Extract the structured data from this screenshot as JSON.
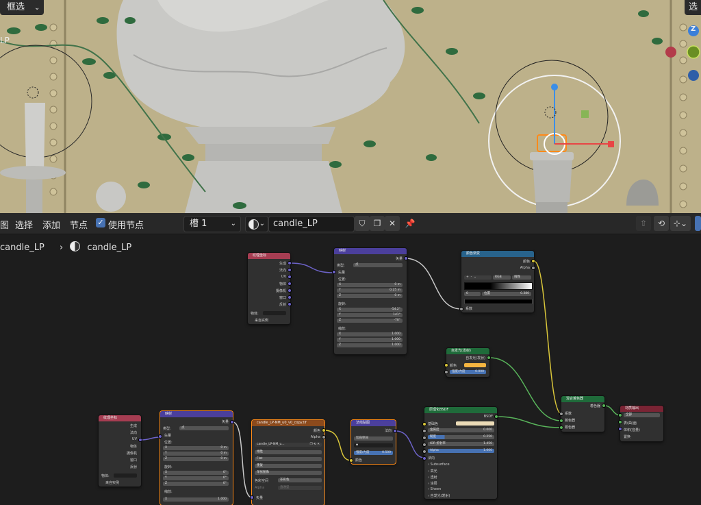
{
  "viewport": {
    "select_mode": "框选",
    "left_label": "LP",
    "right_label": "选",
    "gizmo_z": "Z"
  },
  "header": {
    "menu": [
      "图",
      "选择",
      "添加",
      "节点"
    ],
    "use_nodes_label": "使用节点",
    "slot": "槽 1",
    "material_name": "candle_LP"
  },
  "breadcrumb": {
    "object": "candle_LP",
    "material": "candle_LP"
  },
  "nodes": {
    "texcoord_top": {
      "title": "纹理坐标",
      "outputs": [
        "生成",
        "法向",
        "UV",
        "物体",
        "摄像机",
        "窗口",
        "反射"
      ],
      "object_label": "物体:",
      "from_instancer": "来自实例"
    },
    "mapping_top": {
      "title": "映射",
      "output": "矢量",
      "type_label": "类型:",
      "type_value": "点",
      "input_vector": "矢量",
      "location_label": "位置:",
      "location": [
        {
          "axis": "X",
          "val": "0 m"
        },
        {
          "axis": "Y",
          "val": "0.25 m"
        },
        {
          "axis": "Z",
          "val": "0 m"
        }
      ],
      "rotation_label": "旋转:",
      "rotation": [
        {
          "axis": "X",
          "val": "-54.2°"
        },
        {
          "axis": "Y",
          "val": "141°"
        },
        {
          "axis": "Z",
          "val": "-70°"
        }
      ],
      "scale_label": "缩放:",
      "scale": [
        {
          "axis": "X",
          "val": "1.000"
        },
        {
          "axis": "Y",
          "val": "1.000"
        },
        {
          "axis": "Z",
          "val": "1.000"
        }
      ]
    },
    "colorramp": {
      "title": "颜色渐变",
      "outputs": [
        "颜色",
        "Alpha"
      ],
      "mode": "RGB",
      "interp": "线性",
      "pos_index": "0",
      "pos_label": "位置",
      "pos_value": "0.380",
      "input": "系数"
    },
    "emission": {
      "title": "自发光(发射)",
      "output": "自发光(发射)",
      "color_label": "颜色",
      "strength_label": "强度/力度",
      "strength_value": "0.000",
      "color_hex": "#f5b540"
    },
    "mix_shader": {
      "title": "混合着色器",
      "output": "着色器",
      "inputs": [
        "系数",
        "着色器",
        "着色器"
      ]
    },
    "material_output": {
      "title": "材质输出",
      "target": "全部",
      "inputs": [
        "表(曲)面",
        "体积(音量)",
        "置换"
      ]
    },
    "texcoord_bottom": {
      "title": "纹理坐标",
      "outputs": [
        "生成",
        "法向",
        "UV",
        "物体",
        "摄像机",
        "窗口",
        "反射"
      ],
      "object_label": "物体:",
      "from_instancer": "来自实例"
    },
    "mapping_bottom": {
      "title": "映射",
      "output": "矢量",
      "type_label": "类型:",
      "type_value": "点",
      "input_vector": "矢量",
      "location_label": "位置:",
      "location": [
        {
          "axis": "X",
          "val": "0 m"
        },
        {
          "axis": "Y",
          "val": "0 m"
        },
        {
          "axis": "Z",
          "val": "0 m"
        }
      ],
      "rotation_label": "旋转:",
      "rotation": [
        {
          "axis": "X",
          "val": "0°"
        },
        {
          "axis": "Y",
          "val": "0°"
        },
        {
          "axis": "Z",
          "val": "0°"
        }
      ],
      "scale_label": "缩放:",
      "scale": [
        {
          "axis": "X",
          "val": "1.000"
        }
      ]
    },
    "image_tex": {
      "title": "candle_LP-NM_u0_v0_copy.tif",
      "outputs": [
        "颜色",
        "Alpha"
      ],
      "image_name": "candle_LP-NM_u...",
      "rows": [
        "线性",
        "Flat",
        "重复",
        "单张图像"
      ],
      "colorspace_label": "色彩空间",
      "colorspace_value": "非彩色",
      "alpha_label": "Alpha",
      "alpha_value": "直通型",
      "input": "矢量"
    },
    "normal_map": {
      "title": "法线贴图",
      "output": "法向",
      "space": "切向空间",
      "strength_label": "强度/力度",
      "strength_value": "0.500",
      "color_label": "颜色"
    },
    "bsdf": {
      "title": "原理化BSDF",
      "output": "BSDF",
      "base_color": "基础色",
      "base_color_hex": "#ecdcb8",
      "fields": [
        {
          "l": "金属度",
          "v": "0.000"
        },
        {
          "l": "糙度",
          "v": "0.250"
        },
        {
          "l": "IOR 折射率",
          "v": "1.450"
        },
        {
          "l": "Alpha",
          "v": "1.000"
        }
      ],
      "normal": "法向",
      "panels": [
        "Subsurface",
        "高光",
        "透射",
        "涂层",
        "Sheen",
        "自发光(发射)"
      ]
    }
  }
}
